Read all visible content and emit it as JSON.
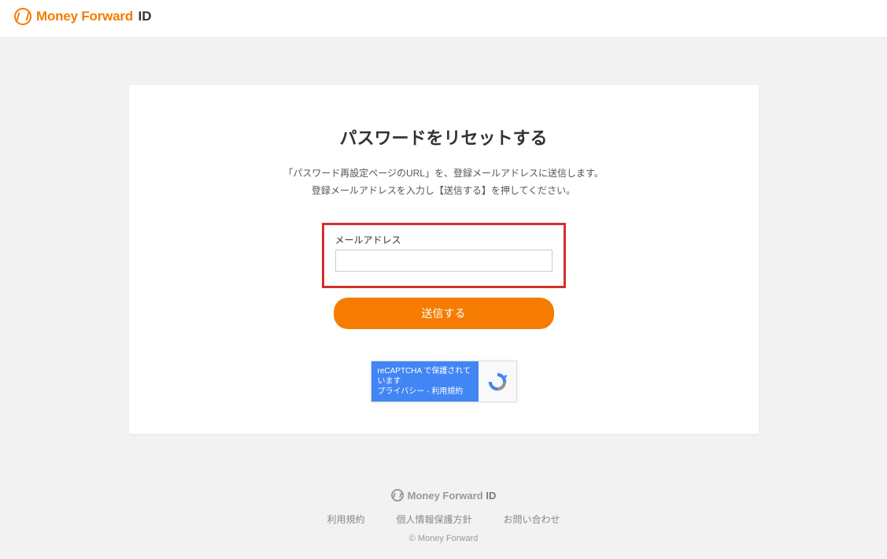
{
  "header": {
    "brand": "Money Forward",
    "suffix": "ID"
  },
  "card": {
    "title": "パスワードをリセットする",
    "desc_line1": "「パスワード再設定ページのURL」を、登録メールアドレスに送信します。",
    "desc_line2": "登録メールアドレスを入力し【送信する】を押してください。",
    "field_label": "メールアドレス",
    "field_value": "",
    "submit_label": "送信する"
  },
  "recaptcha": {
    "protected_text": "reCAPTCHA で保護されています",
    "privacy": "プライバシー",
    "sep": " - ",
    "terms": "利用規約"
  },
  "footer": {
    "brand": "Money Forward",
    "suffix": "ID",
    "links": {
      "terms": "利用規約",
      "privacy": "個人情報保護方針",
      "contact": "お問い合わせ"
    },
    "copyright": "© Money Forward"
  }
}
